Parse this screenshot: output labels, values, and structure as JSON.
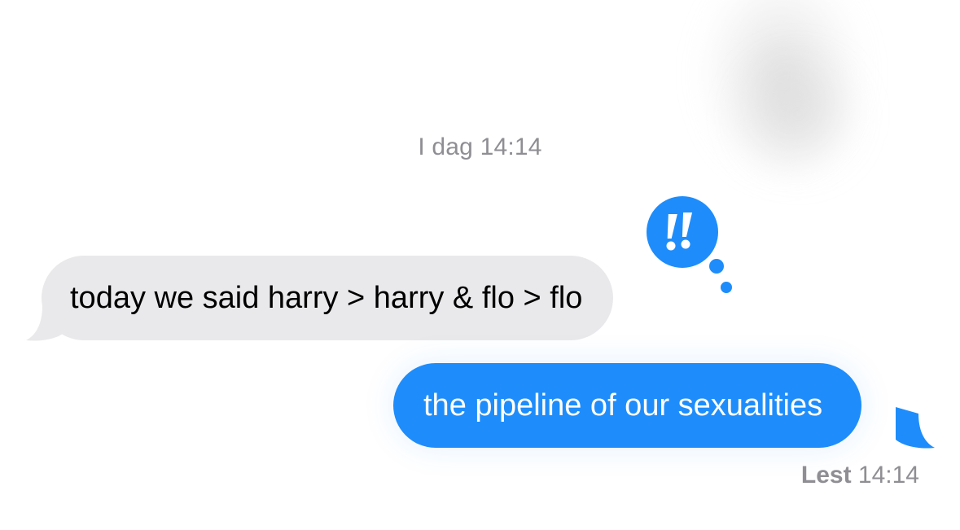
{
  "conversation": {
    "timestamp_label": "I dag 14:14",
    "messages": [
      {
        "direction": "incoming",
        "text": "today we said harry > harry & flo > flo",
        "tapback": "exclamation-icon"
      },
      {
        "direction": "outgoing",
        "text": "the pipeline of our sexualities"
      }
    ],
    "read_receipt": {
      "status": "Lest",
      "time": "14:14"
    }
  },
  "colors": {
    "incoming_bubble": "#e9e9eb",
    "outgoing_bubble": "#1e8dfb",
    "tapback": "#1e8dfb",
    "meta_text": "#8e8e93"
  }
}
